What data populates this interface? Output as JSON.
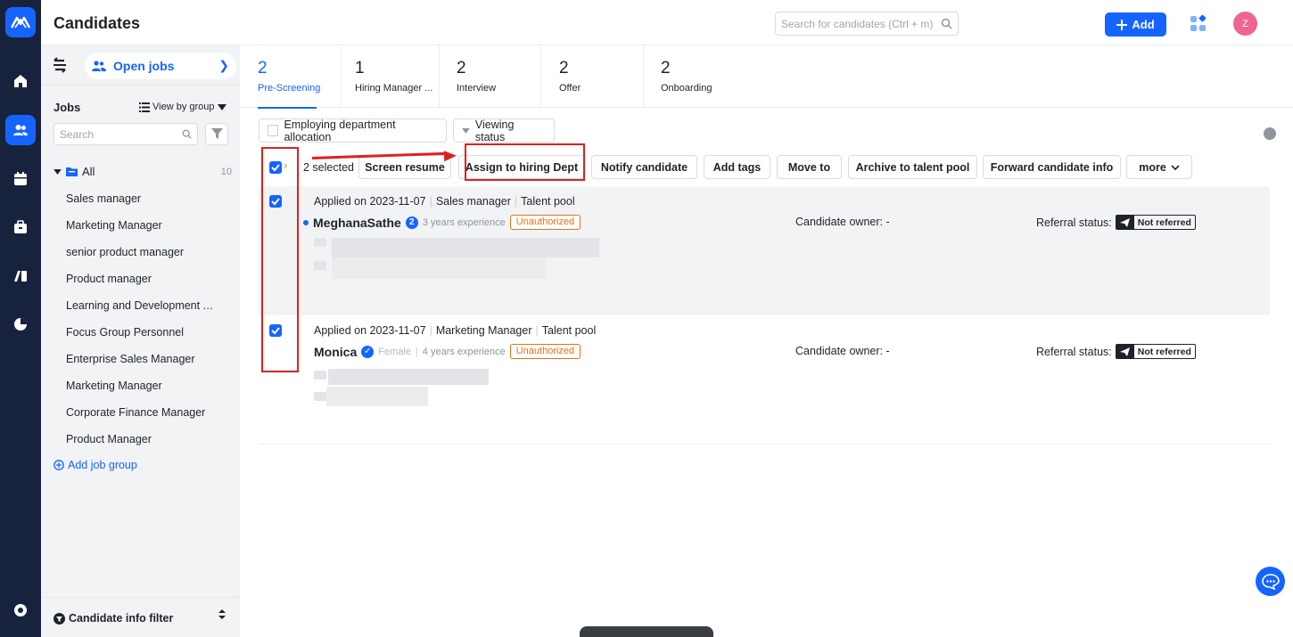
{
  "app": {
    "title": "Candidates"
  },
  "header": {
    "search_placeholder": "Search for candidates (Ctrl + m)",
    "add_label": "Add",
    "avatar_initial": "Z"
  },
  "rail": {
    "items": [
      "home-icon",
      "candidates-icon",
      "calendar-icon",
      "briefcase-icon",
      "reports-icon",
      "analytics-icon",
      "settings-icon"
    ],
    "active": "candidates-icon"
  },
  "sidebar": {
    "open_jobs_label": "Open jobs",
    "jobs_label": "Jobs",
    "view_by_label": "View by group",
    "search_placeholder": "Search",
    "all_label": "All",
    "all_count": "10",
    "jobs": [
      "Sales manager",
      "Marketing Manager",
      "senior product manager",
      "Product manager",
      "Learning and Development A...",
      "Focus Group Personnel",
      "Enterprise Sales Manager",
      "Marketing Manager",
      "Corporate Finance Manager",
      "Product Manager"
    ],
    "add_group_label": "Add job group",
    "footer_label": "Candidate info filter"
  },
  "stages": [
    {
      "count": "2",
      "label": "Pre-Screening",
      "active": true
    },
    {
      "count": "1",
      "label": "Hiring Manager ...",
      "active": false
    },
    {
      "count": "2",
      "label": "Interview",
      "active": false
    },
    {
      "count": "2",
      "label": "Offer",
      "active": false
    },
    {
      "count": "2",
      "label": "Onboarding",
      "active": false
    }
  ],
  "filters": {
    "dept_allocation": "Employing department allocation",
    "viewing_status": "Viewing status"
  },
  "actions": {
    "selected": "2 selected",
    "screen_resume": "Screen resume",
    "assign_dept": "Assign to hiring Dept",
    "notify": "Notify candidate",
    "add_tags": "Add tags",
    "move_to": "Move to",
    "archive": "Archive to talent pool",
    "forward": "Forward candidate info",
    "more": "more"
  },
  "candidates": [
    {
      "applied": "Applied on 2023-11-07",
      "job": "Sales manager",
      "source": "Talent pool",
      "name": "MeghanaSathe",
      "gender": "",
      "experience": "3 years experience",
      "status": "Unauthorized",
      "owner": "Candidate owner: -",
      "referral_label": "Referral status:",
      "referral": "Not referred",
      "checked": true
    },
    {
      "applied": "Applied on 2023-11-07",
      "job": "Marketing Manager",
      "source": "Talent pool",
      "name": "Monica",
      "gender": "Female",
      "experience": "4 years experience",
      "status": "Unauthorized",
      "owner": "Candidate owner: -",
      "referral_label": "Referral status:",
      "referral": "Not referred",
      "checked": true
    }
  ],
  "colors": {
    "primary": "#1664ff",
    "rail_bg": "#17233d",
    "annotation": "#e02020",
    "unauthorized": "#e37318"
  }
}
